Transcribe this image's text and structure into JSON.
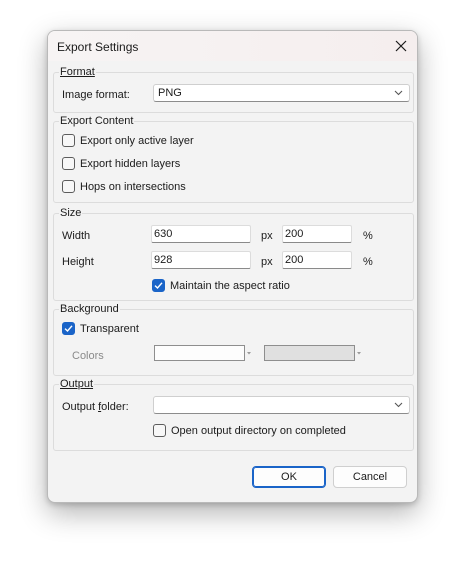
{
  "window": {
    "title": "Export Settings"
  },
  "format": {
    "title": "Format",
    "image_format_label": "Image format:",
    "image_format_value": "PNG"
  },
  "export_content": {
    "title": "Export Content",
    "options": [
      {
        "label": "Export only active layer",
        "checked": false
      },
      {
        "label": "Export hidden layers",
        "checked": false
      },
      {
        "label": "Hops on intersections",
        "checked": false
      }
    ]
  },
  "size": {
    "title": "Size",
    "width_label": "Width",
    "width_px": "630",
    "width_pct": "200",
    "height_label": "Height",
    "height_px": "928",
    "height_pct": "200",
    "px_unit": "px",
    "pct_unit": "%",
    "maintain_label": "Maintain the aspect ratio",
    "maintain_checked": true
  },
  "background": {
    "title": "Background",
    "transparent_label": "Transparent",
    "transparent_checked": true,
    "colors_label": "Colors"
  },
  "output": {
    "title": "Output",
    "folder_label": "Output folder:",
    "folder_value": "",
    "open_dir_label": "Open output directory on completed",
    "open_dir_checked": false
  },
  "buttons": {
    "ok": "OK",
    "cancel": "Cancel"
  },
  "colors": {
    "accent": "#1a64c8",
    "dialog_bg": "#f3f3f3"
  }
}
